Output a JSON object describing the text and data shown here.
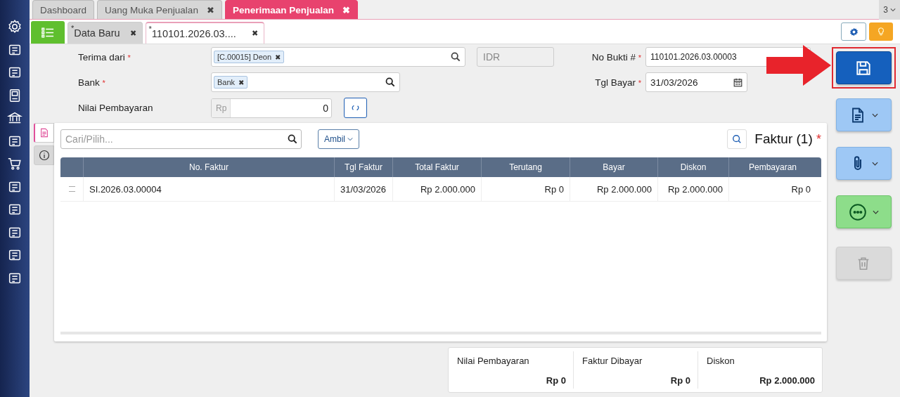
{
  "top_tabs": [
    {
      "label": "Dashboard",
      "selected": false
    },
    {
      "label": "Uang Muka Penjualan",
      "close": "✖",
      "selected": false
    },
    {
      "label": "Penerimaan Penjualan",
      "close": "✖",
      "selected": true
    }
  ],
  "tab_counter": "3",
  "sub_tabs": [
    {
      "prefix": "*",
      "label": "Data Baru",
      "close": "✖",
      "selected": false
    },
    {
      "prefix": "*",
      "label": "110101.2026.03....",
      "close": "✖",
      "selected": true
    }
  ],
  "form": {
    "terima_dari": {
      "label": "Terima dari",
      "mark": "*",
      "tag": "[C.00015] Deon",
      "tag_close": "✖"
    },
    "currency": {
      "placeholder": "IDR"
    },
    "bank": {
      "label": "Bank",
      "mark": "*",
      "tag": "Bank",
      "tag_close": "✖"
    },
    "nilai": {
      "label": "Nilai Pembayaran",
      "prefix": "Rp",
      "value": "0"
    },
    "no_bukti": {
      "label": "No Bukti #",
      "mark": "*",
      "value": "110101.2026.03.00003"
    },
    "tgl_bayar": {
      "label": "Tgl Bayar",
      "mark": "*",
      "value": "31/03/2026"
    }
  },
  "panel": {
    "side_tabs": [
      {
        "kind": "document",
        "selected": true
      },
      {
        "kind": "info",
        "selected": false
      }
    ],
    "search": {
      "placeholder": "Cari/Pilih..."
    },
    "ambil": "Ambil",
    "title": "Faktur (1)",
    "title_mark": "*",
    "table": {
      "columns": [
        "No. Faktur",
        "Tgl Faktur",
        "Total Faktur",
        "Terutang",
        "Bayar",
        "Diskon",
        "Pembayaran"
      ],
      "rows": [
        {
          "cells": [
            "SI.2026.03.00004",
            "31/03/2026",
            "Rp 2.000.000",
            "Rp 0",
            "Rp 2.000.000",
            "Rp 2.000.000",
            "Rp 0"
          ]
        }
      ]
    }
  },
  "summary": [
    {
      "label": "Nilai Pembayaran",
      "value": "Rp 0"
    },
    {
      "label": "Faktur Dibayar",
      "value": "Rp 0"
    },
    {
      "label": "Diskon",
      "value": "Rp 2.000.000"
    }
  ],
  "actions": [
    {
      "kind": "save",
      "highlighted": true,
      "dropdown": false,
      "disabled": false
    },
    {
      "kind": "document",
      "highlighted": false,
      "dropdown": true,
      "disabled": false
    },
    {
      "kind": "attach",
      "highlighted": false,
      "dropdown": true,
      "disabled": false
    },
    {
      "kind": "more",
      "highlighted": false,
      "dropdown": true,
      "disabled": false
    },
    {
      "kind": "delete",
      "highlighted": false,
      "dropdown": false,
      "disabled": true
    }
  ],
  "annotation": {
    "kind": "arrow"
  }
}
